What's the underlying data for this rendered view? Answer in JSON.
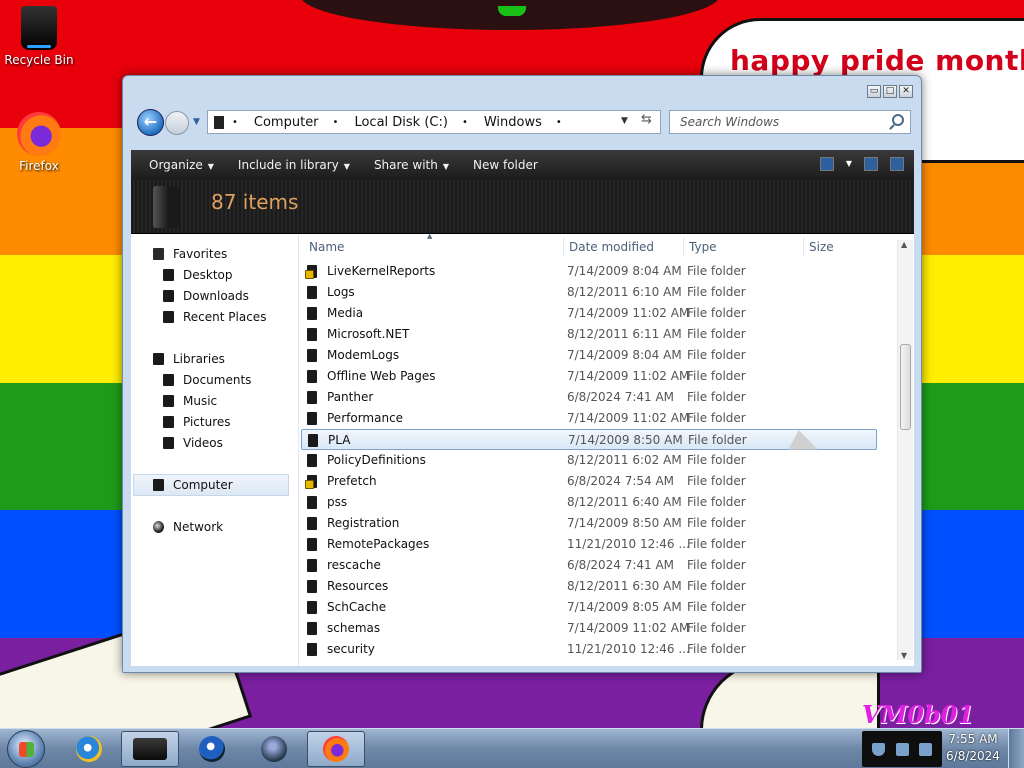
{
  "desktop": {
    "banner_text": "happy pride month",
    "watermark": "VM0b01",
    "icons": [
      {
        "label": "Recycle Bin",
        "icon": "recycle-bin-icon"
      },
      {
        "label": "Firefox",
        "icon": "firefox-icon"
      }
    ]
  },
  "window": {
    "controls": {
      "minimize": "▭",
      "maximize": "□",
      "close": "✕"
    },
    "address": {
      "crumbs": [
        "Computer",
        "Local Disk (C:)",
        "Windows"
      ],
      "separator": "•"
    },
    "search": {
      "placeholder": "Search Windows"
    },
    "command_bar": {
      "organize": "Organize",
      "include_in_library": "Include in library",
      "share_with": "Share with",
      "new_folder": "New folder"
    },
    "header": {
      "items_count": "87 items"
    },
    "nav_pane": {
      "favorites": "Favorites",
      "desktop": "Desktop",
      "downloads": "Downloads",
      "recent_places": "Recent Places",
      "libraries": "Libraries",
      "documents": "Documents",
      "music": "Music",
      "pictures": "Pictures",
      "videos": "Videos",
      "computer": "Computer",
      "network": "Network"
    },
    "columns": {
      "name": "Name",
      "date_modified": "Date modified",
      "type": "Type",
      "size": "Size"
    },
    "files": [
      {
        "name": "LiveKernelReports",
        "date": "7/14/2009 8:04 AM",
        "type": "File folder",
        "locked": true
      },
      {
        "name": "Logs",
        "date": "8/12/2011 6:10 AM",
        "type": "File folder",
        "locked": false
      },
      {
        "name": "Media",
        "date": "7/14/2009 11:02 AM",
        "type": "File folder",
        "locked": false
      },
      {
        "name": "Microsoft.NET",
        "date": "8/12/2011 6:11 AM",
        "type": "File folder",
        "locked": false
      },
      {
        "name": "ModemLogs",
        "date": "7/14/2009 8:04 AM",
        "type": "File folder",
        "locked": false
      },
      {
        "name": "Offline Web Pages",
        "date": "7/14/2009 11:02 AM",
        "type": "File folder",
        "locked": false
      },
      {
        "name": "Panther",
        "date": "6/8/2024 7:41 AM",
        "type": "File folder",
        "locked": false
      },
      {
        "name": "Performance",
        "date": "7/14/2009 11:02 AM",
        "type": "File folder",
        "locked": false
      },
      {
        "name": "PLA",
        "date": "7/14/2009 8:50 AM",
        "type": "File folder",
        "locked": false,
        "selected": true
      },
      {
        "name": "PolicyDefinitions",
        "date": "8/12/2011 6:02 AM",
        "type": "File folder",
        "locked": false
      },
      {
        "name": "Prefetch",
        "date": "6/8/2024 7:54 AM",
        "type": "File folder",
        "locked": true
      },
      {
        "name": "pss",
        "date": "8/12/2011 6:40 AM",
        "type": "File folder",
        "locked": false
      },
      {
        "name": "Registration",
        "date": "7/14/2009 8:50 AM",
        "type": "File folder",
        "locked": false
      },
      {
        "name": "RemotePackages",
        "date": "11/21/2010 12:46 ...",
        "type": "File folder",
        "locked": false
      },
      {
        "name": "rescache",
        "date": "6/8/2024 7:41 AM",
        "type": "File folder",
        "locked": false
      },
      {
        "name": "Resources",
        "date": "8/12/2011 6:30 AM",
        "type": "File folder",
        "locked": false
      },
      {
        "name": "SchCache",
        "date": "7/14/2009 8:05 AM",
        "type": "File folder",
        "locked": false
      },
      {
        "name": "schemas",
        "date": "7/14/2009 11:02 AM",
        "type": "File folder",
        "locked": false
      },
      {
        "name": "security",
        "date": "11/21/2010 12:46 ...",
        "type": "File folder",
        "locked": false
      }
    ]
  },
  "taskbar": {
    "clock_time": "7:55 AM",
    "clock_date": "6/8/2024",
    "apps": [
      "internet-explorer-icon",
      "windows-explorer-icon",
      "windows-media-player-icon",
      "network-globe-icon",
      "firefox-icon"
    ]
  },
  "colors": {
    "pride_text": "#d4001a",
    "selection_border": "#7da2ce",
    "items_count": "#e0a060"
  }
}
